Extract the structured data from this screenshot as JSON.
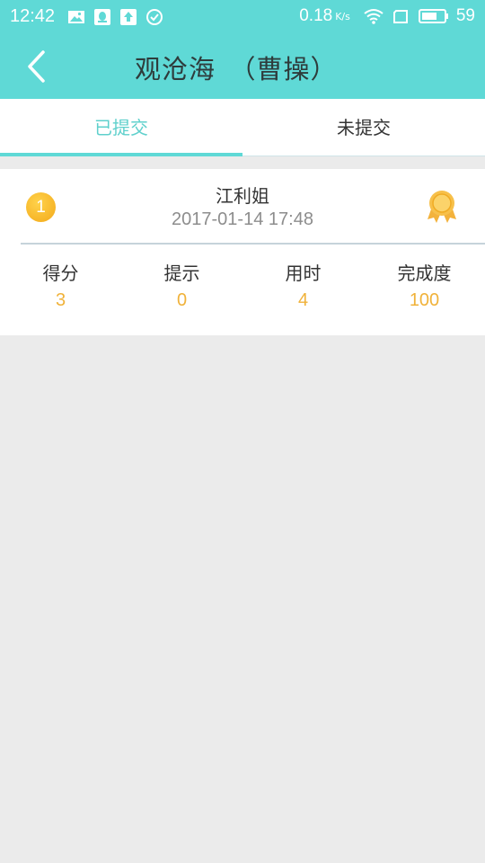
{
  "status_bar": {
    "time": "12:42",
    "speed": "0.18",
    "speed_unit": "K/s",
    "battery": "59",
    "icons": [
      "image-icon",
      "qq-icon",
      "upload-icon",
      "check-circle-icon",
      "wifi-icon",
      "sim-icon",
      "battery-icon"
    ]
  },
  "header": {
    "title": "观沧海　（曹操）",
    "back_icon": "chevron-left-icon",
    "background_color": "#5fd9d6"
  },
  "tabs": [
    {
      "label": "已提交",
      "active": true
    },
    {
      "label": "未提交",
      "active": false
    }
  ],
  "record": {
    "rank": "1",
    "name": "江利姐",
    "time": "2017-01-14 17:48",
    "medal_icon": "medal-icon",
    "stats": [
      {
        "label": "得分",
        "value": "3"
      },
      {
        "label": "提示",
        "value": "0"
      },
      {
        "label": "用时",
        "value": "4"
      },
      {
        "label": "完成度",
        "value": "100"
      }
    ]
  },
  "colors": {
    "accent": "#5fd9d6",
    "value_color": "#f0b23a",
    "background": "#ebebeb"
  }
}
